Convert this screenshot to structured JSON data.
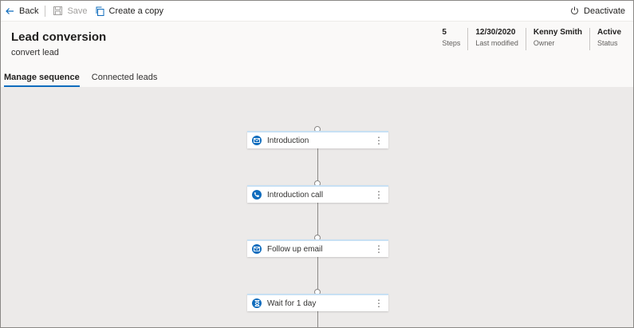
{
  "toolbar": {
    "back_label": "Back",
    "save_label": "Save",
    "copy_label": "Create a copy",
    "deactivate_label": "Deactivate"
  },
  "header": {
    "title": "Lead conversion",
    "subtitle": "convert lead",
    "meta": [
      {
        "value": "5",
        "label": "Steps"
      },
      {
        "value": "12/30/2020",
        "label": "Last modified"
      },
      {
        "value": "Kenny Smith",
        "label": "Owner"
      },
      {
        "value": "Active",
        "label": "Status"
      }
    ]
  },
  "tabs": [
    {
      "label": "Manage sequence",
      "active": true
    },
    {
      "label": "Connected leads",
      "active": false
    }
  ],
  "steps": [
    {
      "label": "Introduction",
      "icon": "email-icon"
    },
    {
      "label": "Introduction call",
      "icon": "phone-icon"
    },
    {
      "label": "Follow up email",
      "icon": "email-icon"
    },
    {
      "label": "Wait for 1 day",
      "icon": "hourglass-icon"
    }
  ],
  "colors": {
    "accent": "#0f6cbd",
    "canvas": "#eceae9",
    "header": "#faf9f8"
  }
}
